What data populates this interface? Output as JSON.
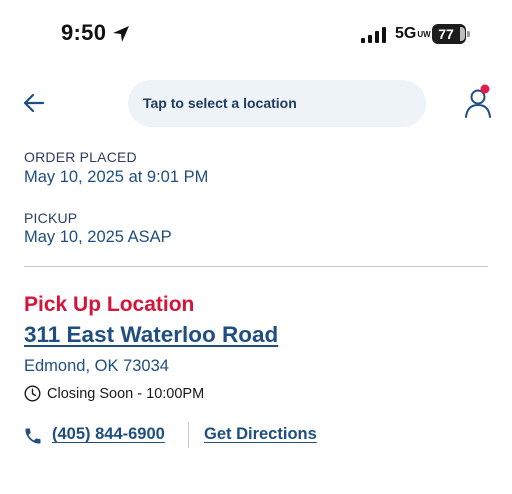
{
  "status_bar": {
    "time": "9:50",
    "network": "5G",
    "network_suffix": "UW",
    "battery": "77",
    "icons": [
      "location-arrow-icon",
      "signal-icon",
      "battery-icon"
    ]
  },
  "header": {
    "back_icon": "arrow-left-icon",
    "location_prompt": "Tap to select a location",
    "profile_icon": "user-icon",
    "profile_badge_color": "#e11d48"
  },
  "order": {
    "placed_label": "ORDER PLACED",
    "placed_value": "May 10, 2025 at 9:01 PM",
    "pickup_label": "PICKUP",
    "pickup_value": "May 10, 2025 ASAP"
  },
  "location": {
    "heading": "Pick Up Location",
    "address": "311 East Waterloo Road",
    "city": "Edmond, OK 73034",
    "hours": "Closing Soon - 10:00PM",
    "phone": "(405) 844-6900",
    "directions": "Get Directions",
    "clock_icon": "clock-icon",
    "phone_icon": "phone-icon"
  },
  "colors": {
    "accent_red": "#d4153a",
    "link_blue": "#1f4e80",
    "pill_bg": "#eef3f7"
  }
}
